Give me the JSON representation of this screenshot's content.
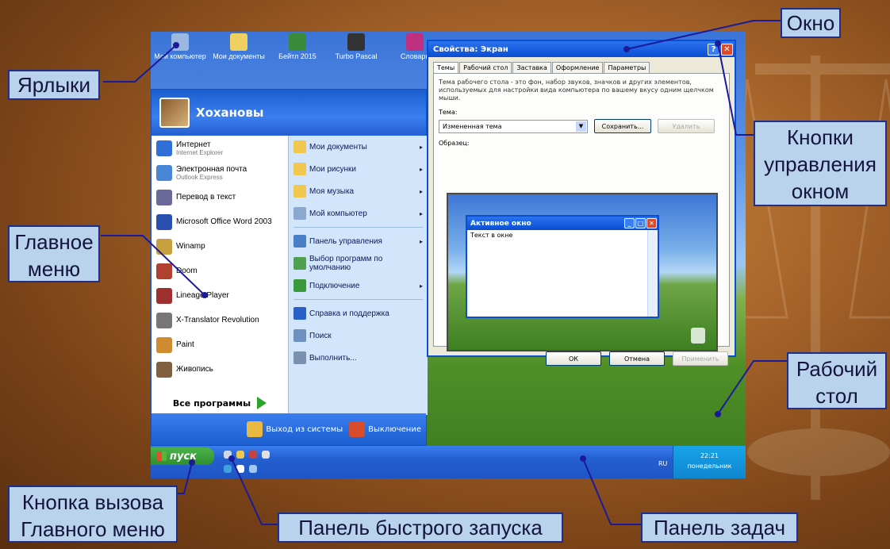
{
  "callouts": {
    "window": "Окно",
    "shortcuts": "Ярлыки",
    "window_buttons_l1": "Кнопки",
    "window_buttons_l2": "управления",
    "window_buttons_l3": "окном",
    "main_menu_l1": "Главное",
    "main_menu_l2": "меню",
    "desktop_l1": "Рабочий",
    "desktop_l2": "стол",
    "start_button_l1": "Кнопка вызова",
    "start_button_l2": "Главного меню",
    "quick_launch": "Панель быстрого запуска",
    "taskbar": "Панель задач"
  },
  "desktop_icons": [
    {
      "label": "Мой компьютер",
      "icon": "computer-icon",
      "color": "#9ab8e0"
    },
    {
      "label": "Мои документы",
      "icon": "folder-icon",
      "color": "#f0d060"
    },
    {
      "label": "Бейтл 2015",
      "icon": "program-icon",
      "color": "#3a8a3a"
    },
    {
      "label": "Turbo Pascal",
      "icon": "turbo-pascal-icon",
      "color": "#333333"
    },
    {
      "label": "Словарь",
      "icon": "book-icon",
      "color": "#c03080"
    }
  ],
  "start_menu": {
    "user": "Хохановы",
    "left_items": [
      {
        "label": "Интернет",
        "sub": "Internet Explorer",
        "icon": "internet-explorer-icon",
        "color": "#2f6fd8"
      },
      {
        "label": "Электронная почта",
        "sub": "Outlook Express",
        "icon": "mail-icon",
        "color": "#4a86d8"
      },
      {
        "label": "Перевод в текст",
        "sub": "",
        "icon": "scanner-icon",
        "color": "#6a6a9a"
      },
      {
        "label": "Microsoft Office Word 2003",
        "sub": "",
        "icon": "word-icon",
        "color": "#2a4fb0"
      },
      {
        "label": "Winamp",
        "sub": "",
        "icon": "winamp-icon",
        "color": "#c8a040"
      },
      {
        "label": "Doom",
        "sub": "",
        "icon": "game-icon",
        "color": "#b04030"
      },
      {
        "label": "Lineage Player",
        "sub": "",
        "icon": "player-icon",
        "color": "#a03030"
      },
      {
        "label": "X-Translator Revolution",
        "sub": "",
        "icon": "clock-icon",
        "color": "#777777"
      },
      {
        "label": "Paint",
        "sub": "",
        "icon": "paint-icon",
        "color": "#d08a30"
      },
      {
        "label": "Живопись",
        "sub": "",
        "icon": "brush-icon",
        "color": "#806040"
      }
    ],
    "all_programs": "Все программы",
    "right_items": [
      {
        "label": "Мои документы",
        "icon": "folder-icon",
        "color": "#f0c850",
        "arrow": "▸"
      },
      {
        "label": "Мои рисунки",
        "icon": "folder-icon",
        "color": "#f0c850",
        "arrow": "▸"
      },
      {
        "label": "Моя музыка",
        "icon": "folder-icon",
        "color": "#f0c850",
        "arrow": "▸"
      },
      {
        "label": "Мой компьютер",
        "icon": "computer-icon",
        "color": "#8aa8d0",
        "arrow": "▸"
      },
      {
        "label": "Панель управления",
        "icon": "control-panel-icon",
        "color": "#4a80c8",
        "arrow": "▸"
      },
      {
        "label": "Выбор программ по умолчанию",
        "icon": "default-programs-icon",
        "color": "#50a050",
        "arrow": ""
      },
      {
        "label": "Подключение",
        "icon": "network-icon",
        "color": "#3a9a3a",
        "arrow": "▸"
      },
      {
        "label": "Справка и поддержка",
        "icon": "help-icon",
        "color": "#2a5fc8",
        "arrow": ""
      },
      {
        "label": "Поиск",
        "icon": "search-icon",
        "color": "#7090c0",
        "arrow": ""
      },
      {
        "label": "Выполнить...",
        "icon": "run-icon",
        "color": "#7a90b0",
        "arrow": ""
      }
    ],
    "logoff": "Выход из системы",
    "shutdown": "Выключение"
  },
  "properties_window": {
    "title": "Свойства: Экран",
    "tabs": [
      "Темы",
      "Рабочий стол",
      "Заставка",
      "Оформление",
      "Параметры"
    ],
    "description": "Тема рабочего стола - это фон, набор звуков, значков и других элементов, используемых для настройки вида компьютера по вашему вкусу одним щелчком мыши.",
    "theme_label": "Тема:",
    "theme_value": "Измененная тема",
    "save": "Сохранить...",
    "delete": "Удалить",
    "sample_label": "Образец:",
    "active_window_title": "Активное окно",
    "active_window_text": "Текст в окне",
    "ok": "ОК",
    "cancel": "Отмена",
    "apply": "Применить"
  },
  "taskbar": {
    "start": "пуск",
    "lang": "RU",
    "time": "22:21",
    "day": "понедельник"
  }
}
